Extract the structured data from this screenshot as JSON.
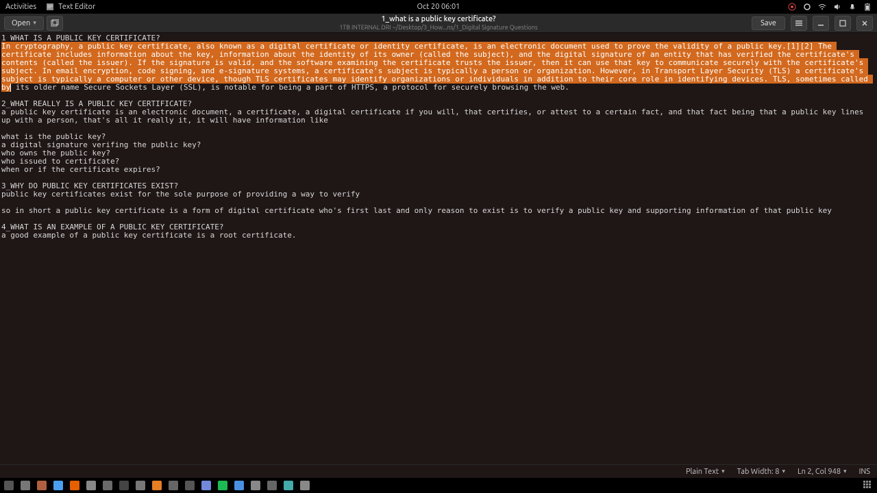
{
  "panel": {
    "activities": "Activities",
    "app_name": "Text Editor",
    "clock": "Oct 20  06:01"
  },
  "titlebar": {
    "open_label": "Open",
    "save_label": "Save",
    "title": "1_what is a public key certificate?",
    "subtitle": "1TB INTERNAL DRI ~/Desktop/3_How...ns/1_Digital Signature Questions"
  },
  "document": {
    "line1": "1_WHAT IS A PUBLIC KEY CERTIFICATE?",
    "selected": "In cryptography, a public key certificate, also known as a digital certificate or identity certificate, is an electronic document used to prove the validity of a public key.[1][2] The certificate includes information about the key, information about the identity of its owner (called the subject), and the digital signature of an entity that has verified the certificate's contents (called the issuer). If the signature is valid, and the software examining the certificate trusts the issuer, then it can use that key to communicate securely with the certificate's subject. In email encryption, code signing, and e-signature systems, a certificate's subject is typically a person or organization. However, in Transport Layer Security (TLS) a certificate's subject is typically a computer or other device, though TLS certificates may identify organizations or individuals in addition to their core role in identifying devices. TLS, sometimes called by",
    "after_selection": " its older name Secure Sockets Layer (SSL), is notable for being a part of HTTPS, a protocol for securely browsing the web.",
    "blank1": "",
    "heading2": "2_WHAT REALLY IS A PUBLIC KEY CERTIFICATE?",
    "para2a": "a public key certificate is an electronic document, a certificate, a digital certificate if you will, that certifies, or attest to a certain fact, and that fact being that a public key lines up with a person, that's all it really it, it will have information like",
    "blank2": "",
    "q1": "what is the public key?",
    "q2": "a digital signature verifing the public key?",
    "q3": "who owns the public key?",
    "q4": "who issued to certificate?",
    "q5": "when or if the certificate expires?",
    "blank3": "",
    "heading3": "3_WHY DO PUBLIC KEY CERTIFICATES EXIST?",
    "para3a": "public key certificates exist for the sole purpose of providing a way to verify",
    "blank4": "",
    "para3b": "so in short a public key certificate is a form of digital certificate who's first last and only reason to exist is to verify a public key and supporting information of that public key",
    "blank5": "",
    "heading4": "4_WHAT IS AN EXAMPLE OF A PUBLIC KEY CERTIFICATE?",
    "para4": "a good example of a public key certificate is a root certificate."
  },
  "statusbar": {
    "syntax": "Plain Text",
    "tabwidth": "Tab Width: 8",
    "position": "Ln 2, Col 948",
    "insert_mode": "INS"
  },
  "dock_icons": [
    "files-icon",
    "screenshot-icon",
    "calendar-icon",
    "chrome-icon",
    "firefox-icon",
    "hex-icon",
    "steam-icon",
    "terminal-icon",
    "settings-icon",
    "vlc-icon",
    "camera-icon",
    "grid-app-icon",
    "discord-icon",
    "spotify-icon",
    "chat-icon",
    "gedit-icon",
    "dvd-icon",
    "writer-icon",
    "cinema-icon"
  ],
  "dock_colors": [
    "#555",
    "#777",
    "#b06040",
    "#4aa0ee",
    "#e66000",
    "#888",
    "#6a6a6a",
    "#444",
    "#777",
    "#e67e22",
    "#666",
    "#555",
    "#7289da",
    "#1db954",
    "#4a90e2",
    "#888",
    "#666",
    "#4aa",
    "#888"
  ]
}
